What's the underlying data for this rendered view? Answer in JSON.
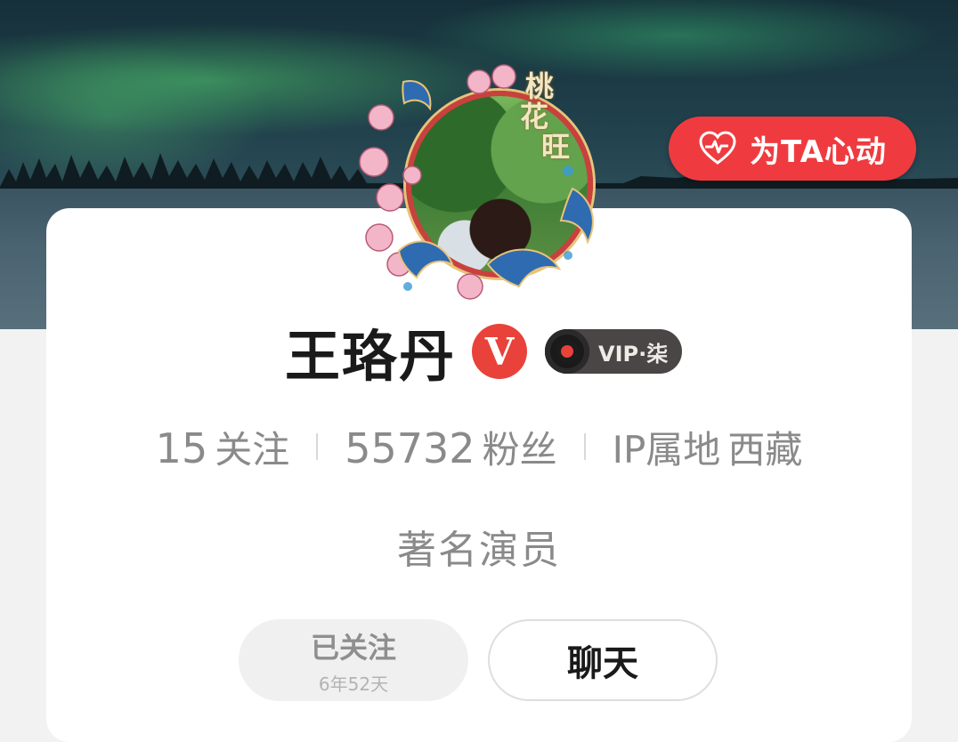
{
  "header": {
    "heart_button_label": "为TA心动",
    "frame_title_chars": [
      "桃",
      "花",
      "旺"
    ]
  },
  "profile": {
    "name": "王珞丹",
    "verified_mark": "V",
    "vip_label": "VIP·柒"
  },
  "stats": {
    "following_count": "15",
    "following_label": "关注",
    "followers_count": "55732",
    "followers_label": "粉丝",
    "ip_label": "IP属地",
    "ip_location": "西藏"
  },
  "bio": "著名演员",
  "actions": {
    "followed_label": "已关注",
    "followed_duration": "6年52天",
    "chat_label": "聊天"
  },
  "colors": {
    "accent_red": "#ef3b3f",
    "verified_red": "#e8423a",
    "vip_dark": "#4a4646"
  },
  "icons": {
    "heart_button_icon": "heart-pulse-icon",
    "vip_icon": "vinyl-disc-icon",
    "verified_icon": "verified-v-icon"
  }
}
